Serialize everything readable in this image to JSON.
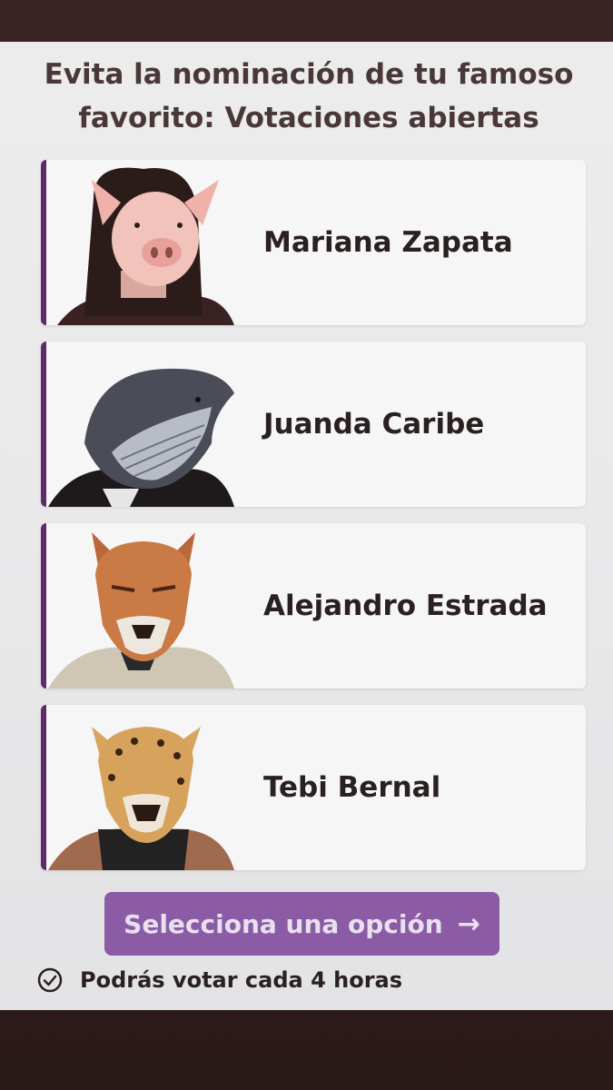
{
  "header": {
    "title": "Evita la nominación de tu famoso favorito: Votaciones abiertas"
  },
  "candidates": [
    {
      "name": "Mariana Zapata",
      "icon": "pig-head-portrait"
    },
    {
      "name": "Juanda Caribe",
      "icon": "whale-head-portrait"
    },
    {
      "name": "Alejandro Estrada",
      "icon": "fox-head-portrait"
    },
    {
      "name": "Tebi Bernal",
      "icon": "jaguar-head-portrait"
    }
  ],
  "footer": {
    "cta_label": "Selecciona una opción",
    "cta_arrow": "→",
    "note": "Podrás votar cada 4 horas",
    "note_icon": "check-circle-icon"
  },
  "colors": {
    "accent": "#5f2a6b",
    "button": "#8b5ba6",
    "button_text": "#e9e0ef"
  }
}
